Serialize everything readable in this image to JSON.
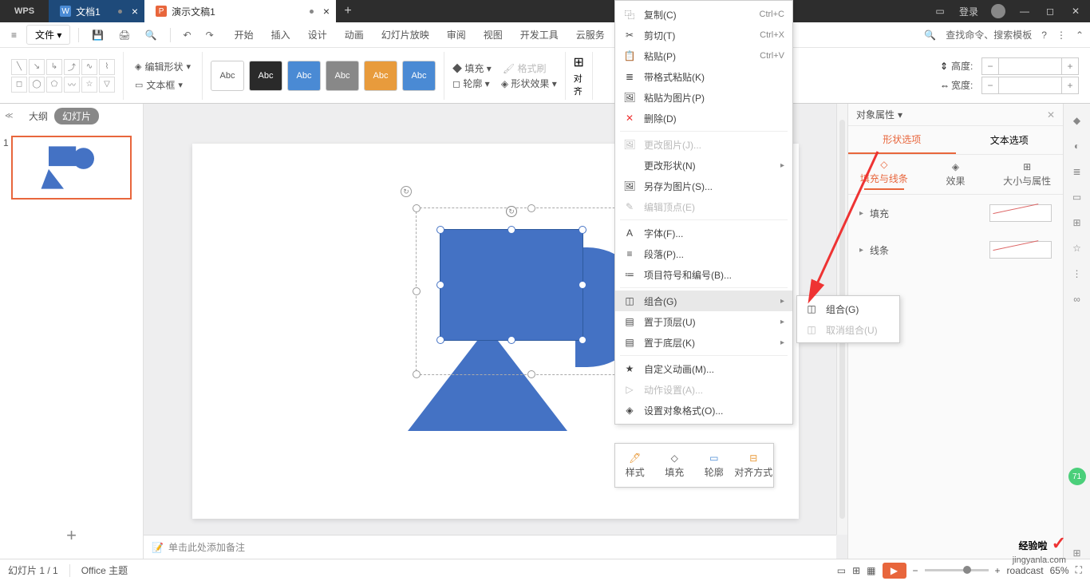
{
  "titlebar": {
    "logo": "WPS",
    "tabs": [
      {
        "icon": "W",
        "label": "文档1"
      },
      {
        "icon": "P",
        "label": "演示文稿1"
      }
    ],
    "login": "登录"
  },
  "menubar": {
    "file": "文件",
    "tabs": [
      "开始",
      "插入",
      "设计",
      "动画",
      "幻灯片放映",
      "审阅",
      "视图",
      "开发工具",
      "云服务"
    ],
    "search": "查找命令、搜索模板"
  },
  "ribbon": {
    "edit_shape": "编辑形状",
    "textbox": "文本框",
    "style": "Abc",
    "fill": "填充",
    "format_brush": "格式刷",
    "outline": "轮廓",
    "effect": "形状效果",
    "align": "对齐",
    "height": "高度:",
    "width": "宽度:"
  },
  "thumbs": {
    "outline": "大纲",
    "slides": "幻灯片",
    "num": "1"
  },
  "notes_placeholder": "单击此处添加备注",
  "context_menu": [
    {
      "icon": "⿻",
      "label": "复制(C)",
      "shortcut": "Ctrl+C"
    },
    {
      "icon": "✂",
      "label": "剪切(T)",
      "shortcut": "Ctrl+X"
    },
    {
      "icon": "📋",
      "label": "粘贴(P)",
      "shortcut": "Ctrl+V"
    },
    {
      "icon": "≣",
      "label": "带格式粘贴(K)"
    },
    {
      "icon": "🖼",
      "label": "粘贴为图片(P)"
    },
    {
      "icon": "✕",
      "label": "删除(D)",
      "red": true
    },
    {
      "sep": true
    },
    {
      "icon": "🖼",
      "label": "更改图片(J)...",
      "dis": true
    },
    {
      "icon": "",
      "label": "更改形状(N)",
      "sub": true
    },
    {
      "icon": "🖼",
      "label": "另存为图片(S)..."
    },
    {
      "icon": "✎",
      "label": "编辑顶点(E)",
      "dis": true
    },
    {
      "sep": true
    },
    {
      "icon": "A",
      "label": "字体(F)..."
    },
    {
      "icon": "≡",
      "label": "段落(P)..."
    },
    {
      "icon": "≔",
      "label": "项目符号和编号(B)..."
    },
    {
      "sep": true
    },
    {
      "icon": "◫",
      "label": "组合(G)",
      "sub": true,
      "hl": true
    },
    {
      "icon": "▤",
      "label": "置于顶层(U)",
      "sub": true
    },
    {
      "icon": "▤",
      "label": "置于底层(K)",
      "sub": true
    },
    {
      "sep": true
    },
    {
      "icon": "★",
      "label": "自定义动画(M)..."
    },
    {
      "icon": "▷",
      "label": "动作设置(A)...",
      "dis": true
    },
    {
      "icon": "◈",
      "label": "设置对象格式(O)..."
    }
  ],
  "submenu": [
    {
      "icon": "◫",
      "label": "组合(G)"
    },
    {
      "icon": "◫",
      "label": "取消组合(U)",
      "dis": true
    }
  ],
  "float_toolbar": [
    "样式",
    "填充",
    "轮廓",
    "对齐方式"
  ],
  "right_pane": {
    "title": "对象属性",
    "tabs": [
      "形状选项",
      "文本选项"
    ],
    "subtabs": [
      "填充与线条",
      "效果",
      "大小与属性"
    ],
    "rows": [
      "填充",
      "线条"
    ]
  },
  "status": {
    "slide": "幻灯片 1 / 1",
    "theme": "Office 主题",
    "zoom": "65%"
  },
  "watermark": {
    "main": "经验啦",
    "sub": "jingyanla.com",
    "badge": "71"
  }
}
